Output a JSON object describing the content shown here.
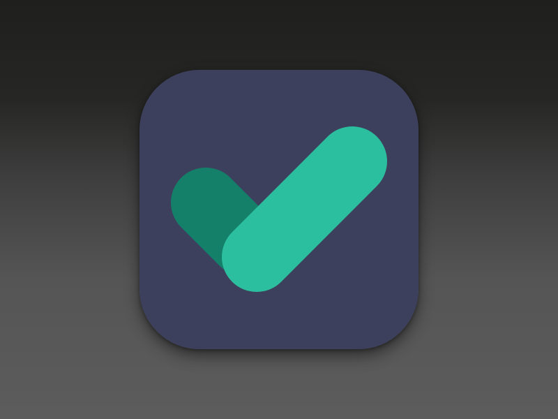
{
  "icon": {
    "semantic_name": "checkmark-icon",
    "colors": {
      "background_top": "#1f1f1d",
      "background_bottom": "#5c5c5c",
      "tile": "#3d405c",
      "short_stroke": "#14806a",
      "long_stroke": "#2cbf9f",
      "overlap": "#23a289"
    }
  }
}
